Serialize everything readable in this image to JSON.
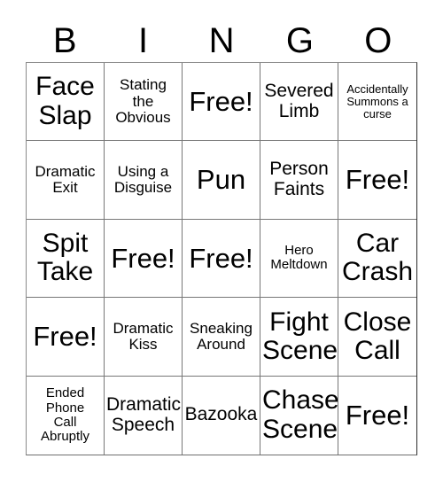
{
  "card": {
    "header_letters": [
      "B",
      "I",
      "N",
      "G",
      "O"
    ],
    "free_space_label": "Free!",
    "colors": {
      "text": "#000000",
      "grid_line": "#777777",
      "background": "#ffffff"
    },
    "rows": [
      [
        {
          "text": "Face\nSlap",
          "size": "s-lg"
        },
        {
          "text": "Stating\nthe\nObvious",
          "size": "s-sm"
        },
        {
          "text": "Free!",
          "size": "s-xl"
        },
        {
          "text": "Severed\nLimb",
          "size": "s-md"
        },
        {
          "text": "Accidentally\nSummons a\ncurse",
          "size": "s-xxs"
        }
      ],
      [
        {
          "text": "Dramatic\nExit",
          "size": "s-sm"
        },
        {
          "text": "Using a\nDisguise",
          "size": "s-sm"
        },
        {
          "text": "Pun",
          "size": "s-xl"
        },
        {
          "text": "Person\nFaints",
          "size": "s-md"
        },
        {
          "text": "Free!",
          "size": "s-xl"
        }
      ],
      [
        {
          "text": "Spit\nTake",
          "size": "s-lg"
        },
        {
          "text": "Free!",
          "size": "s-xl"
        },
        {
          "text": "Free!",
          "size": "s-xl"
        },
        {
          "text": "Hero\nMeltdown",
          "size": "s-xs"
        },
        {
          "text": "Car\nCrash",
          "size": "s-lg"
        }
      ],
      [
        {
          "text": "Free!",
          "size": "s-xl"
        },
        {
          "text": "Dramatic\nKiss",
          "size": "s-sm"
        },
        {
          "text": "Sneaking\nAround",
          "size": "s-sm"
        },
        {
          "text": "Fight\nScene",
          "size": "s-lg"
        },
        {
          "text": "Close\nCall",
          "size": "s-lg"
        }
      ],
      [
        {
          "text": "Ended\nPhone\nCall\nAbruptly",
          "size": "s-xs"
        },
        {
          "text": "Dramatic\nSpeech",
          "size": "s-md"
        },
        {
          "text": "Bazooka",
          "size": "s-md"
        },
        {
          "text": "Chase\nScene",
          "size": "s-lg"
        },
        {
          "text": "Free!",
          "size": "s-xl"
        }
      ]
    ]
  }
}
